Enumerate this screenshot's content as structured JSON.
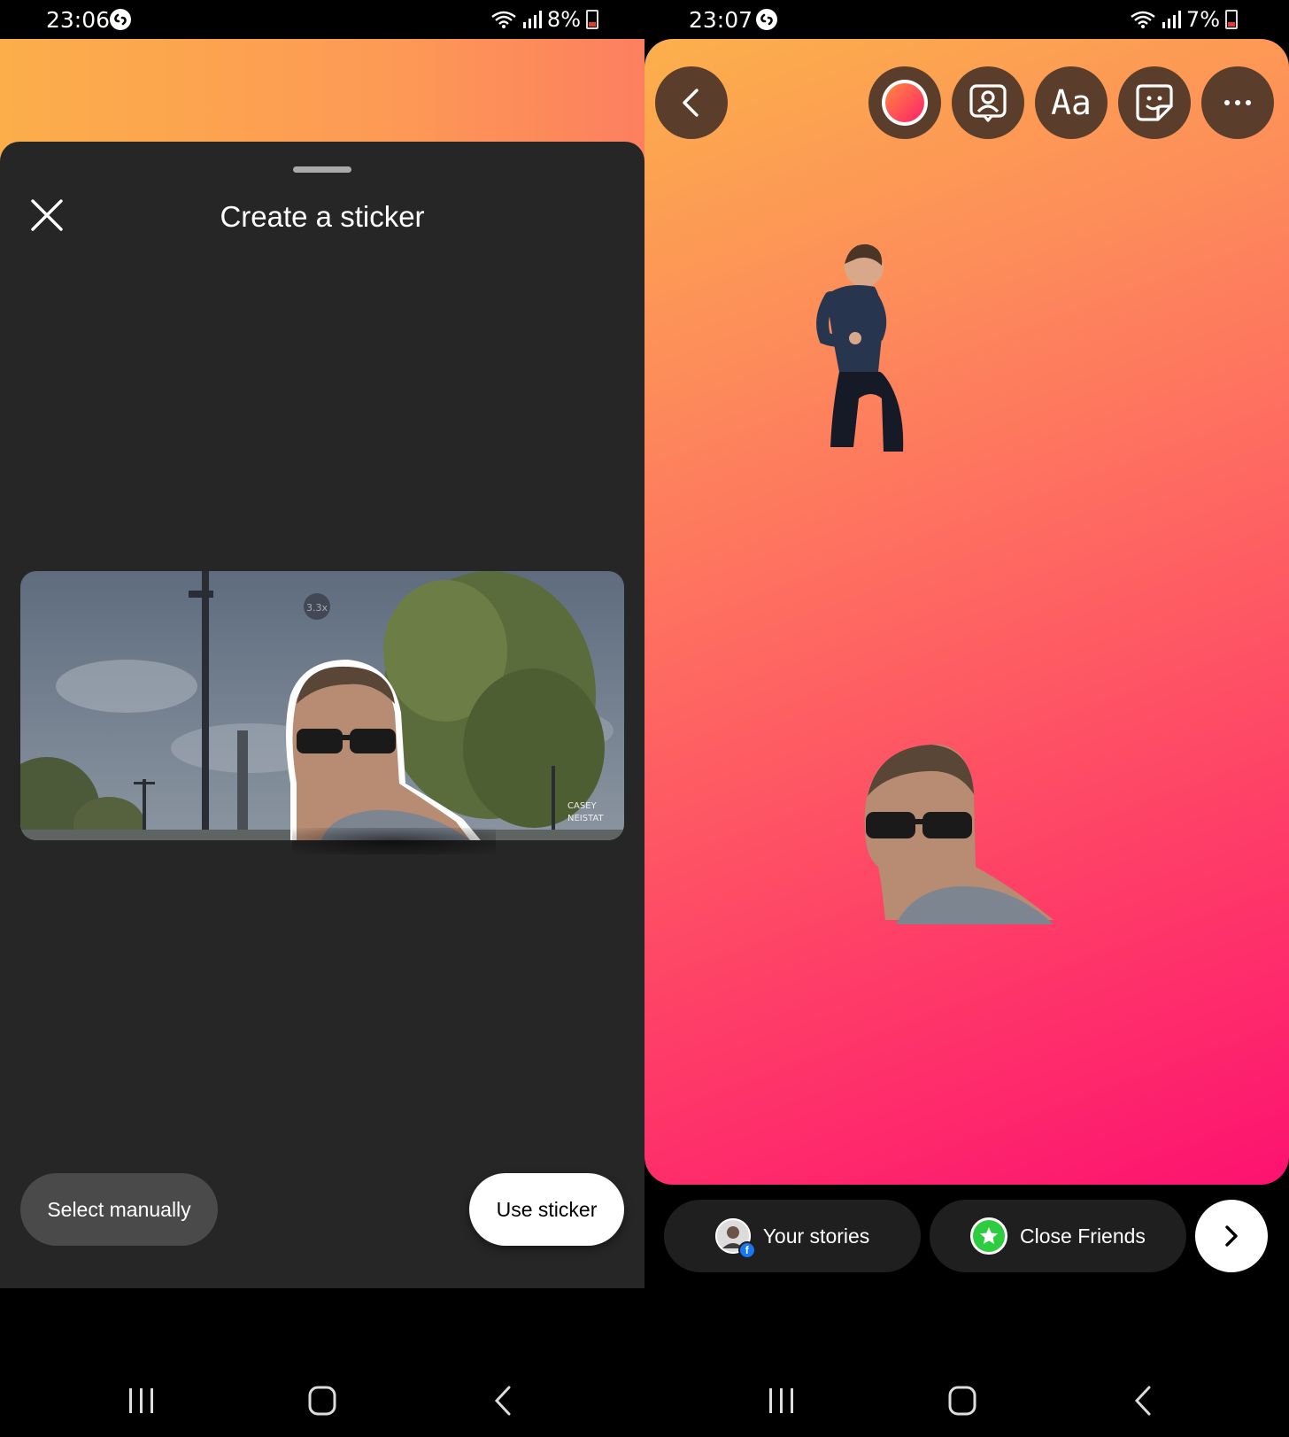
{
  "left": {
    "status": {
      "time": "23:06",
      "battery": "8%"
    },
    "sheet": {
      "title": "Create a sticker"
    },
    "buttons": {
      "select_manually": "Select manually",
      "use_sticker": "Use sticker"
    }
  },
  "right": {
    "status": {
      "time": "23:07",
      "battery": "7%"
    },
    "toolbar": {
      "text_tool_label": "Aa"
    },
    "share": {
      "your_stories": "Your stories",
      "close_friends": "Close Friends"
    }
  },
  "colors": {
    "sheet_bg": "#262626",
    "tool_button_bg": "#5b3d2b",
    "close_friends_green": "#2ecc40",
    "facebook_blue": "#1877f2"
  },
  "icons": {
    "left": [
      "close-icon",
      "shazam-icon",
      "wifi-icon",
      "signal-icon",
      "battery-icon"
    ],
    "right": [
      "back-chevron-icon",
      "effects-circle-icon",
      "tag-person-icon",
      "sticker-icon",
      "more-dots-icon",
      "facebook-icon",
      "star-icon",
      "next-chevron-icon"
    ],
    "navbar": [
      "recents-icon",
      "home-icon",
      "back-icon"
    ]
  }
}
